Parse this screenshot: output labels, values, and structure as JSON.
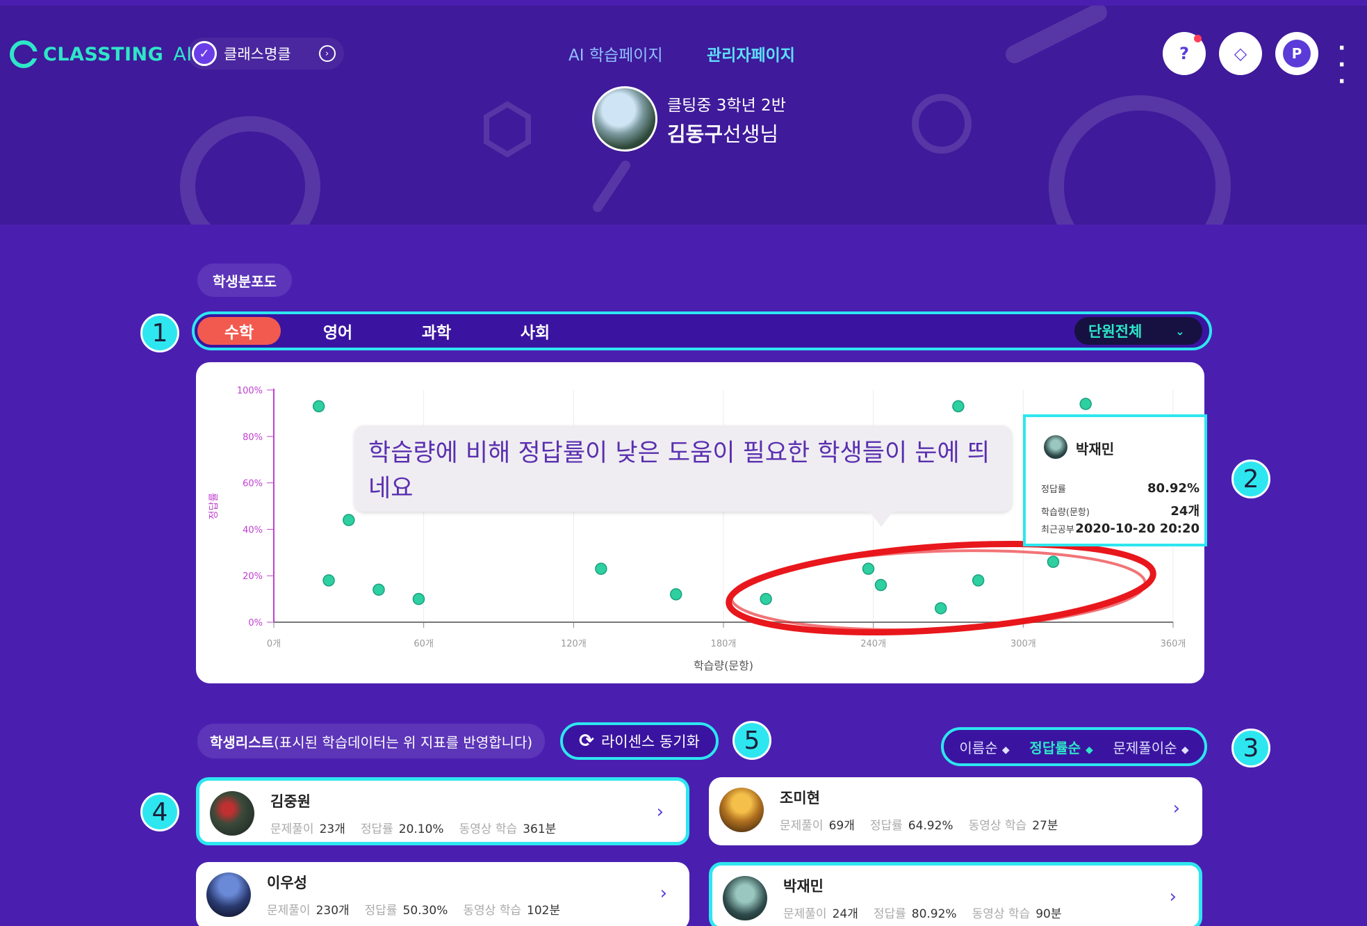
{
  "header": {
    "brand": "CLASSTING",
    "brand_suffix": "AI",
    "class_badge": "클래스명클",
    "nav": {
      "ai_page": "AI 학습페이지",
      "admin_page": "관리자페이지"
    },
    "icons": [
      "help-chat-icon",
      "ticket-icon",
      "profile-icon",
      "more-icon"
    ],
    "profile_initial": "P",
    "teacher_class": "클팅중 3학년 2반",
    "teacher_name_bold": "김동구",
    "teacher_name_suffix": "선생님"
  },
  "distribution": {
    "section_label": "학생분포도",
    "tabs": [
      "수학",
      "영어",
      "과학",
      "사회"
    ],
    "active_tab": "수학",
    "unit_filter": "단원전체"
  },
  "tooltip_text": "학습량에 비해 정답률이 낮은 도움이 필요한 학생들이 눈에 띄네요",
  "info_card": {
    "name": "박재민",
    "rows": [
      {
        "label": "정답률",
        "value": "80.92%"
      },
      {
        "label": "학습량(문항)",
        "value": "24개"
      },
      {
        "label": "최근공부",
        "value": "2020-10-20 20:20"
      }
    ]
  },
  "badges": [
    "1",
    "2",
    "3",
    "4",
    "5"
  ],
  "chart_data": {
    "type": "scatter",
    "xlabel": "학습량(문항)",
    "ylabel": "정답률",
    "x_ticks": [
      "0개",
      "60개",
      "120개",
      "180개",
      "240개",
      "300개",
      "360개"
    ],
    "y_ticks": [
      "0%",
      "20%",
      "40%",
      "60%",
      "80%",
      "100%"
    ],
    "xlim": [
      0,
      360
    ],
    "ylim": [
      0,
      100
    ],
    "grid": true,
    "highlight_color": "#e8171c",
    "point_color": "#2ecfa0",
    "points": [
      {
        "x": 18,
        "y": 93
      },
      {
        "x": 22,
        "y": 18
      },
      {
        "x": 30,
        "y": 44
      },
      {
        "x": 42,
        "y": 14
      },
      {
        "x": 58,
        "y": 10
      },
      {
        "x": 131,
        "y": 23
      },
      {
        "x": 161,
        "y": 12
      },
      {
        "x": 197,
        "y": 10
      },
      {
        "x": 238,
        "y": 23
      },
      {
        "x": 243,
        "y": 16
      },
      {
        "x": 267,
        "y": 6
      },
      {
        "x": 274,
        "y": 93
      },
      {
        "x": 282,
        "y": 18
      },
      {
        "x": 312,
        "y": 26
      },
      {
        "x": 325,
        "y": 94
      }
    ]
  },
  "list": {
    "section_label_bold": "학생리스트",
    "section_label_rest": "(표시된 학습데이터는 위 지표를 반영합니다)",
    "license_sync": "라이센스 동기화",
    "sort": [
      "이름순",
      "정답률순",
      "문제풀이순"
    ],
    "active_sort": "정답률순",
    "stat_labels": {
      "solved": "문제풀이",
      "accuracy": "정답률",
      "video": "동영상 학습"
    },
    "students": [
      {
        "name": "김중원",
        "solved": "23개",
        "accuracy": "20.10%",
        "video": "361분"
      },
      {
        "name": "조미현",
        "solved": "69개",
        "accuracy": "64.92%",
        "video": "27분"
      },
      {
        "name": "이우성",
        "solved": "230개",
        "accuracy": "50.30%",
        "video": "102분"
      },
      {
        "name": "박재민",
        "solved": "24개",
        "accuracy": "80.92%",
        "video": "90분"
      }
    ]
  }
}
